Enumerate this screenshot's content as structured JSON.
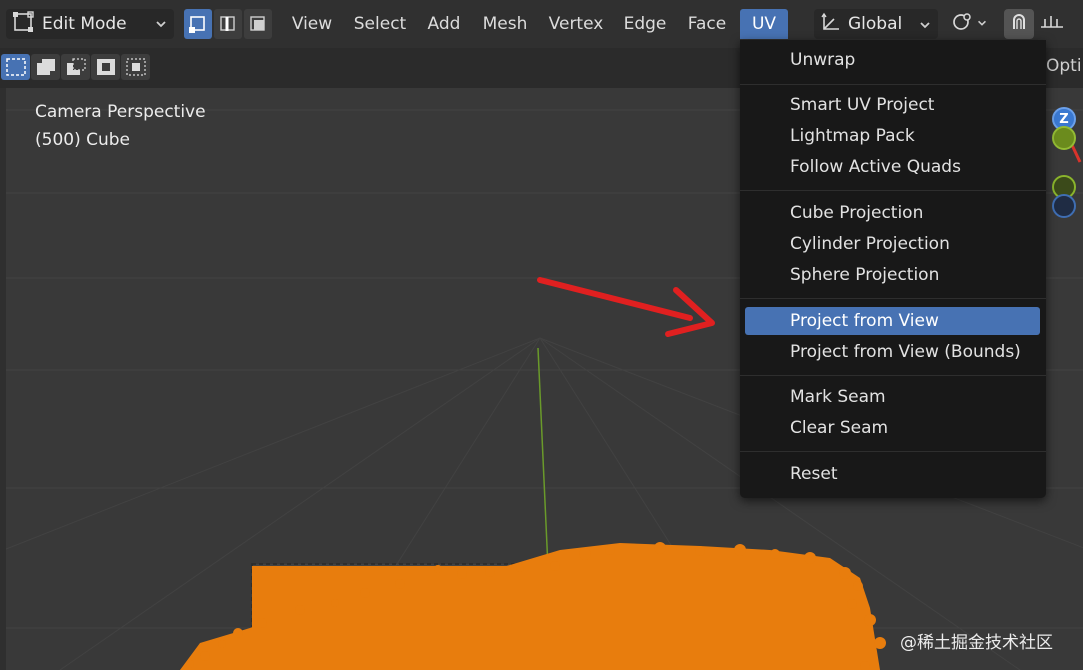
{
  "header": {
    "mode": "Edit Mode",
    "menus": [
      "View",
      "Select",
      "Add",
      "Mesh",
      "Vertex",
      "Edge",
      "Face",
      "UV"
    ],
    "active_menu": "UV",
    "orientation": "Global",
    "options_label": "Opti"
  },
  "viewport": {
    "view_name": "Camera Perspective",
    "object_info": "(500) Cube"
  },
  "uv_menu": {
    "items": [
      "Unwrap",
      "Smart UV Project",
      "Lightmap Pack",
      "Follow Active Quads",
      "Cube Projection",
      "Cylinder Projection",
      "Sphere Projection",
      "Project from View",
      "Project from View (Bounds)",
      "Mark Seam",
      "Clear Seam",
      "Reset"
    ],
    "highlighted_index": 7
  },
  "gizmo": {
    "z_label": "Z"
  },
  "watermark": "@稀土掘金技术社区",
  "colors": {
    "accent": "#4772b3",
    "selection_orange": "#e87d0d",
    "arrow_red": "#e02020",
    "menu_bg": "#181818"
  },
  "icons": {
    "mode": "edit-mode-icon",
    "orientation": "transform-orientation-icon",
    "snap": "snap-icon",
    "proportional": "proportional-edit-icon"
  }
}
